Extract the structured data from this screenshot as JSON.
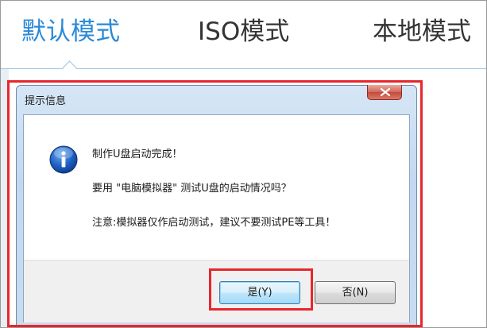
{
  "tabs": [
    {
      "label": "默认模式",
      "active": true
    },
    {
      "label": "ISO模式",
      "active": false
    },
    {
      "label": "本地模式",
      "active": false
    }
  ],
  "dialog": {
    "title": "提示信息",
    "icon": "info-icon",
    "messages": [
      "制作U盘启动完成！",
      "要用 \"电脑模拟器\" 测试U盘的启动情况吗？",
      "注意:模拟器仅作启动测试，建议不要测试PE等工具！"
    ],
    "buttons": {
      "yes": "是(Y)",
      "no": "否(N)"
    }
  },
  "colors": {
    "active_tab": "#2a8ad8",
    "highlight": "#e8262d"
  }
}
